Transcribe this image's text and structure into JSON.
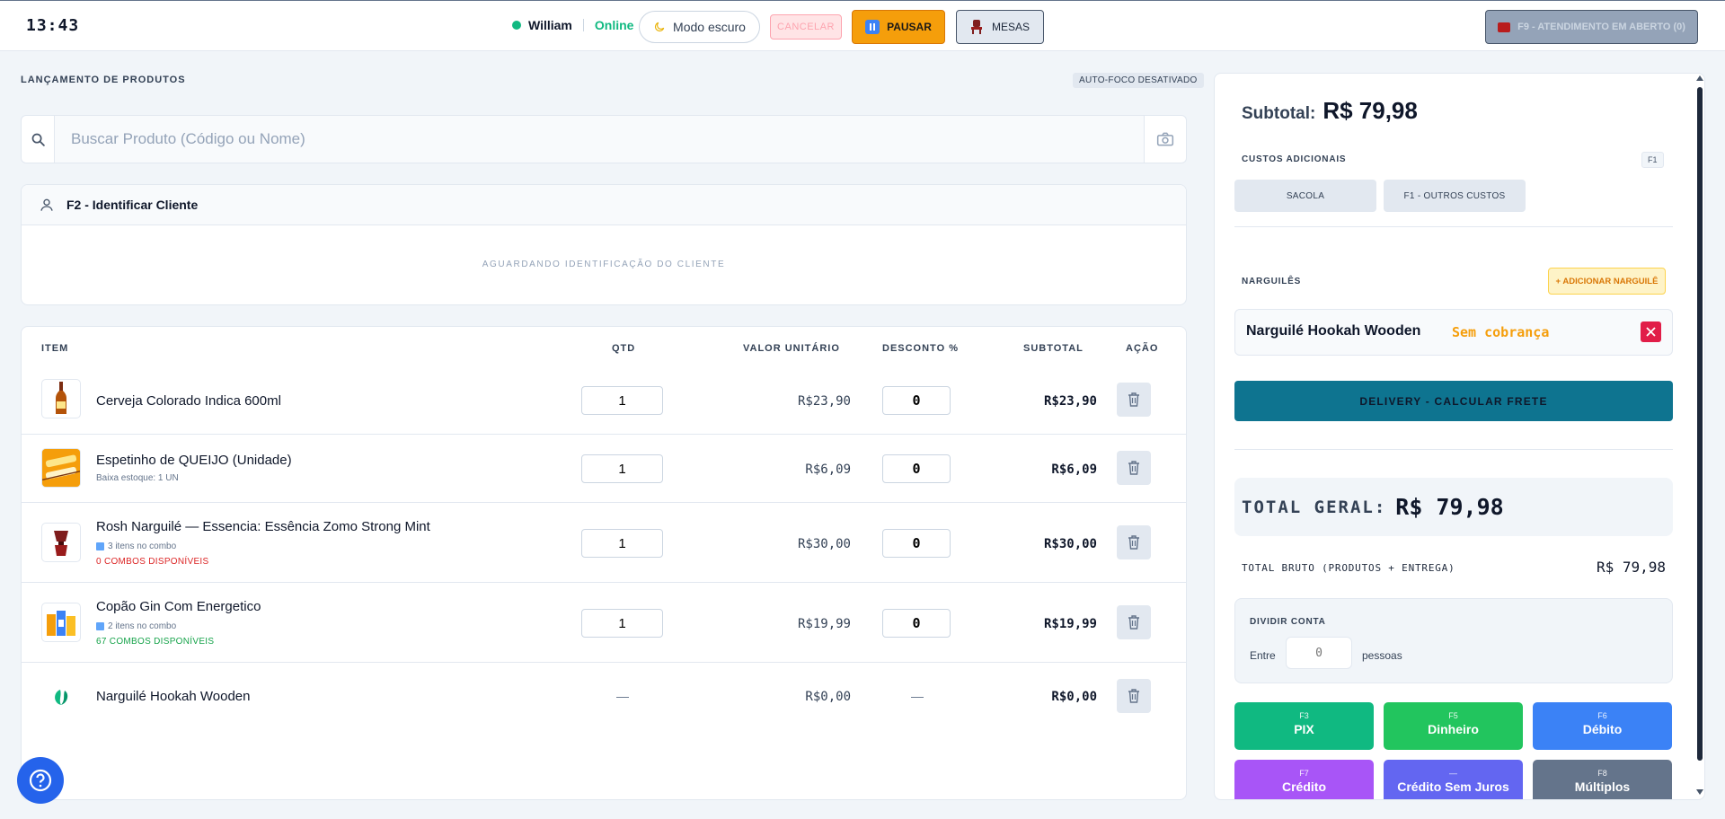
{
  "header": {
    "clock": "13:43",
    "user_name": "William",
    "user_status": "Online",
    "dark_mode_label": "Modo escuro",
    "cancel_label": "CANCELAR",
    "pause_label": "PAUSAR",
    "tables_label": "MESAS",
    "f9_label": "F9 - ATENDIMENTO EM ABERTO (0)"
  },
  "launch": {
    "title": "LANÇAMENTO DE PRODUTOS",
    "autofocus": "AUTO-FOCO DESATIVADO",
    "search_placeholder": "Buscar Produto (Código ou Nome)"
  },
  "client": {
    "label": "F2 - Identificar Cliente",
    "waiting": "AGUARDANDO IDENTIFICAÇÃO DO CLIENTE"
  },
  "table": {
    "headers": {
      "item": "ITEM",
      "qty": "QTD",
      "unit": "VALOR UNITÁRIO",
      "discount": "DESCONTO %",
      "subtotal": "SUBTOTAL",
      "action": "AÇÃO"
    },
    "rows": [
      {
        "name": "Cerveja Colorado Indica 600ml",
        "qty": "1",
        "unit": "R$23,90",
        "discount": "0",
        "subtotal": "R$23,90",
        "icon": "beer-bottle-icon"
      },
      {
        "name": "Espetinho de QUEIJO (Unidade)",
        "sub1": "Baixa estoque: 1 UN",
        "qty": "1",
        "unit": "R$6,09",
        "discount": "0",
        "subtotal": "R$6,09",
        "icon": "cheese-skewer-icon"
      },
      {
        "name": "Rosh Narguilé — Essencia: Essência Zomo Strong Mint",
        "sub1": "3 itens no combo",
        "sub2": "0 COMBOS DISPONÍVEIS",
        "sub2_color": "#dc2626",
        "qty": "1",
        "unit": "R$30,00",
        "discount": "0",
        "subtotal": "R$30,00",
        "icon": "hookah-bowl-icon"
      },
      {
        "name": "Copão Gin Com Energetico",
        "sub1": "2 itens no combo",
        "sub2": "67 COMBOS DISPONÍVEIS",
        "sub2_color": "#16a34a",
        "qty": "1",
        "unit": "R$19,99",
        "discount": "0",
        "subtotal": "R$19,99",
        "icon": "gin-cup-icon"
      },
      {
        "name": "Narguilé Hookah Wooden",
        "qty": "—",
        "unit": "R$0,00",
        "discount": "—",
        "subtotal": "R$0,00",
        "icon": "leaf-icon"
      }
    ]
  },
  "summary": {
    "subtotal_label": "Subtotal:",
    "subtotal_value": "R$ 79,98",
    "extra_costs_label": "CUSTOS ADICIONAIS",
    "extra_costs_key": "F1",
    "bag_label": "SACOLA",
    "other_costs_label": "F1 - OUTROS CUSTOS",
    "hookahs_label": "NARGUILÊS",
    "add_hookah_label": "+ ADICIONAR NARGUILÊ",
    "hookah_item_name": "Narguilé Hookah Wooden",
    "hookah_item_status": "Sem cobrança",
    "delivery_label": "DELIVERY - CALCULAR FRETE",
    "total_label": "TOTAL GERAL:",
    "total_value": "R$ 79,98",
    "gross_label": "TOTAL BRUTO (PRODUTOS + ENTREGA)",
    "gross_value": "R$ 79,98",
    "split_label": "DIVIDIR CONTA",
    "split_between": "Entre",
    "split_people_placeholder": "0",
    "split_people": "pessoas",
    "payments": [
      {
        "key": "F3",
        "label": "PIX",
        "color": "#10b981"
      },
      {
        "key": "F5",
        "label": "Dinheiro",
        "color": "#22c55e"
      },
      {
        "key": "F6",
        "label": "Débito",
        "color": "#3b82f6"
      },
      {
        "key": "F7",
        "label": "Crédito",
        "color": "#a855f7"
      },
      {
        "key": "—",
        "label": "Crédito Sem Juros",
        "color": "#6366f1"
      },
      {
        "key": "F8",
        "label": "Múltiplos",
        "color": "#64748b"
      }
    ]
  }
}
